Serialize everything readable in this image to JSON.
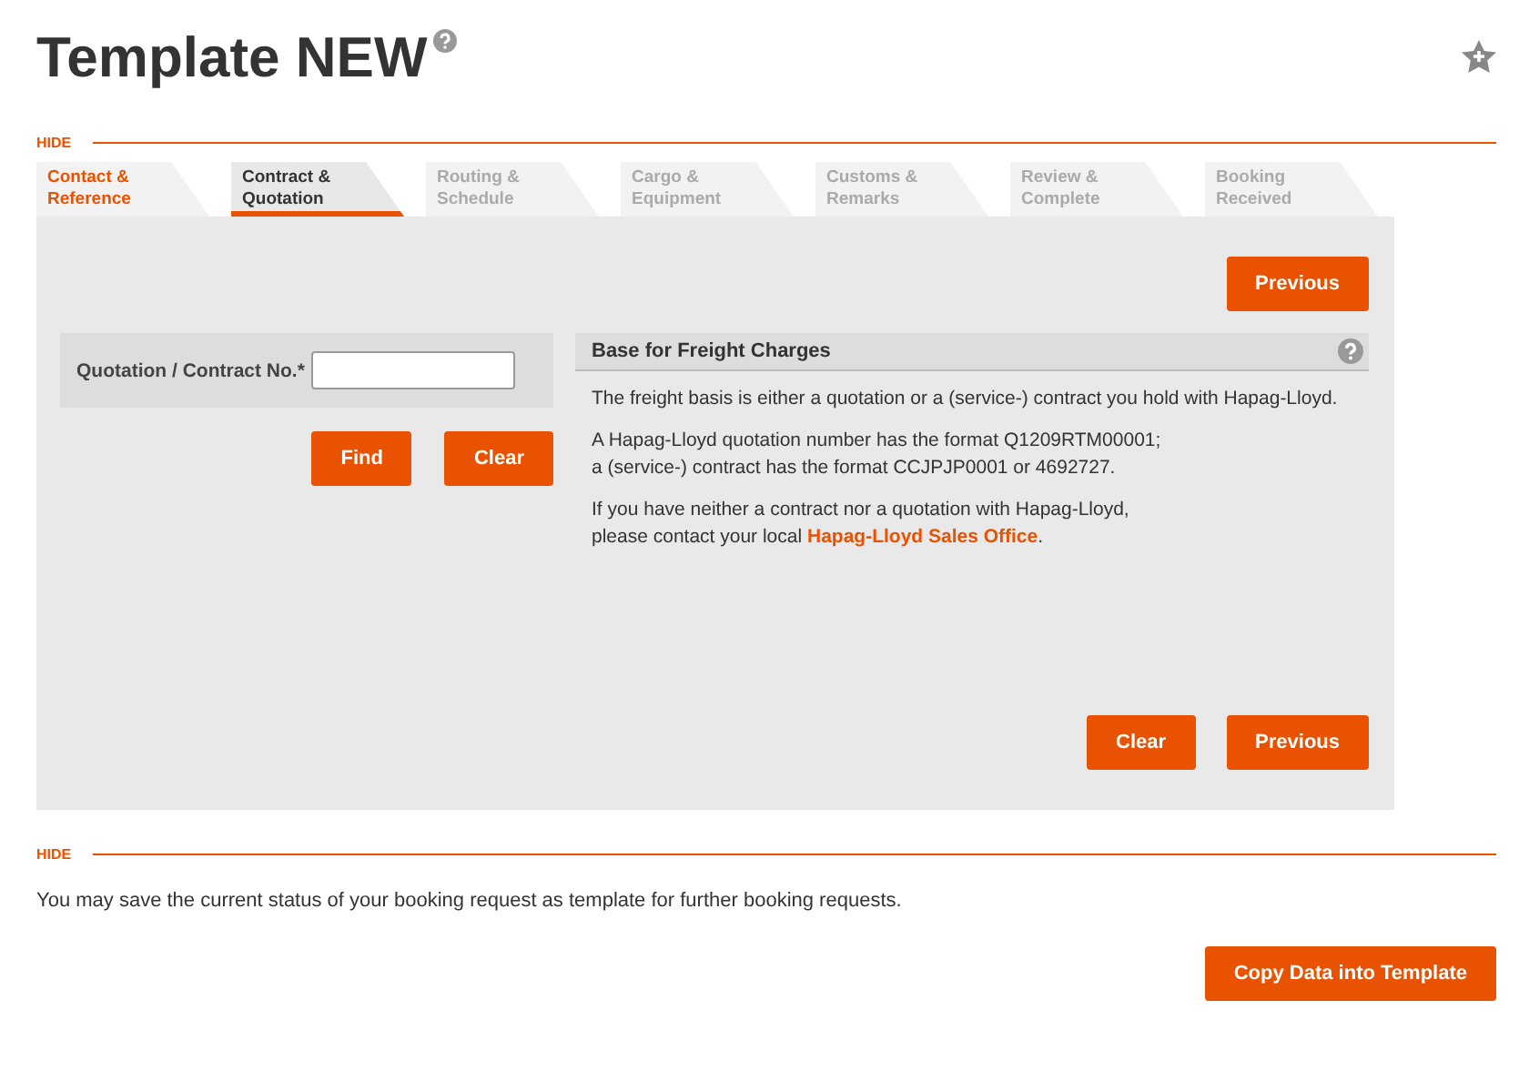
{
  "title": "Template NEW",
  "sections": [
    {
      "toggle": "HIDE"
    },
    {
      "toggle": "HIDE"
    }
  ],
  "steps": [
    {
      "label": "Contact &\nReference",
      "selected": false,
      "completed": true
    },
    {
      "label": "Contract &\nQuotation",
      "selected": true,
      "completed": false
    },
    {
      "label": "Routing &\nSchedule",
      "selected": false,
      "completed": false
    },
    {
      "label": "Cargo &\nEquipment",
      "selected": false,
      "completed": false
    },
    {
      "label": "Customs &\nRemarks",
      "selected": false,
      "completed": false
    },
    {
      "label": "Review &\nComplete",
      "selected": false,
      "completed": false
    },
    {
      "label": "Booking\nReceived",
      "selected": false,
      "completed": false
    }
  ],
  "top_button": "Previous",
  "form": {
    "label": "Quotation / Contract No.*",
    "buttons": [
      "Find",
      "Clear"
    ]
  },
  "info": {
    "title": "Base for Freight Charges",
    "paragraphs": [
      {
        "text": "The freight basis is either a quotation or a (service-) contract you hold with Hapag-Lloyd."
      },
      {
        "text": "A Hapag-Lloyd quotation number has the format Q1209RTM00001;\na (service-) contract has the format CCJPJP0001 or 4692727."
      },
      {
        "text": "If you have neither a contract nor a quotation with Hapag-Lloyd,\nplease contact your local ",
        "link": "Hapag-Lloyd Sales Office",
        "after": "."
      }
    ]
  },
  "bottom_buttons": [
    "Clear",
    "Previous"
  ],
  "template": {
    "note": "You may save the current status of your booking request as template for further booking requests.",
    "button": "Copy Data into Template"
  }
}
